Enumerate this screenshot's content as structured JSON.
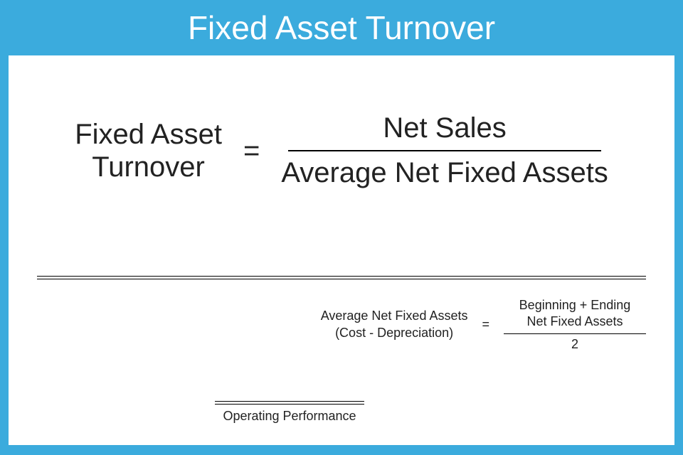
{
  "header": {
    "title": "Fixed Asset Turnover"
  },
  "main_formula": {
    "lhs_line1": "Fixed Asset",
    "lhs_line2": "Turnover",
    "equals": "=",
    "numerator": "Net Sales",
    "denominator": "Average Net Fixed Assets"
  },
  "sub_formula": {
    "lhs_line1": "Average Net Fixed Assets",
    "lhs_line2": "(Cost - Depreciation)",
    "equals": "=",
    "numerator_line1": "Beginning + Ending",
    "numerator_line2": "Net Fixed Assets",
    "denominator": "2"
  },
  "footer": {
    "topic": "Operating Performance"
  }
}
